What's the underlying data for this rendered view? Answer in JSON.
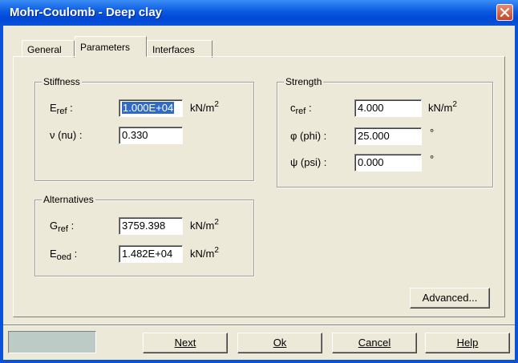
{
  "window": {
    "title": "Mohr-Coulomb - Deep clay"
  },
  "tabs": [
    {
      "label": "General"
    },
    {
      "label": "Parameters"
    },
    {
      "label": "Interfaces"
    }
  ],
  "stiffness": {
    "title": "Stiffness",
    "eref": {
      "sym": "E",
      "sub": "ref",
      "value": "1.000E+04",
      "unit": "kN/m",
      "exp": "2"
    },
    "nu": {
      "label": "ν (nu) :",
      "value": "0.330"
    }
  },
  "strength": {
    "title": "Strength",
    "cref": {
      "sym": "c",
      "sub": "ref",
      "value": "4.000",
      "unit": "kN/m",
      "exp": "2"
    },
    "phi": {
      "label": "φ (phi) :",
      "value": "25.000",
      "unit": "°"
    },
    "psi": {
      "label": "ψ (psi) :",
      "value": "0.000",
      "unit": "°"
    }
  },
  "alternatives": {
    "title": "Alternatives",
    "gref": {
      "sym": "G",
      "sub": "ref",
      "value": "3759.398",
      "unit": "kN/m",
      "exp": "2"
    },
    "eoed": {
      "sym": "E",
      "sub": "oed",
      "value": "1.482E+04",
      "unit": "kN/m",
      "exp": "2"
    }
  },
  "buttons": {
    "advanced": "Advanced...",
    "next": "Next",
    "ok": "Ok",
    "cancel": "Cancel",
    "help": "Help"
  },
  "colors": {
    "titlebar": "#0a52d6",
    "dialog_bg": "#ece9d8",
    "selection": "#316ac5",
    "status_box": "#bdcbc6"
  }
}
